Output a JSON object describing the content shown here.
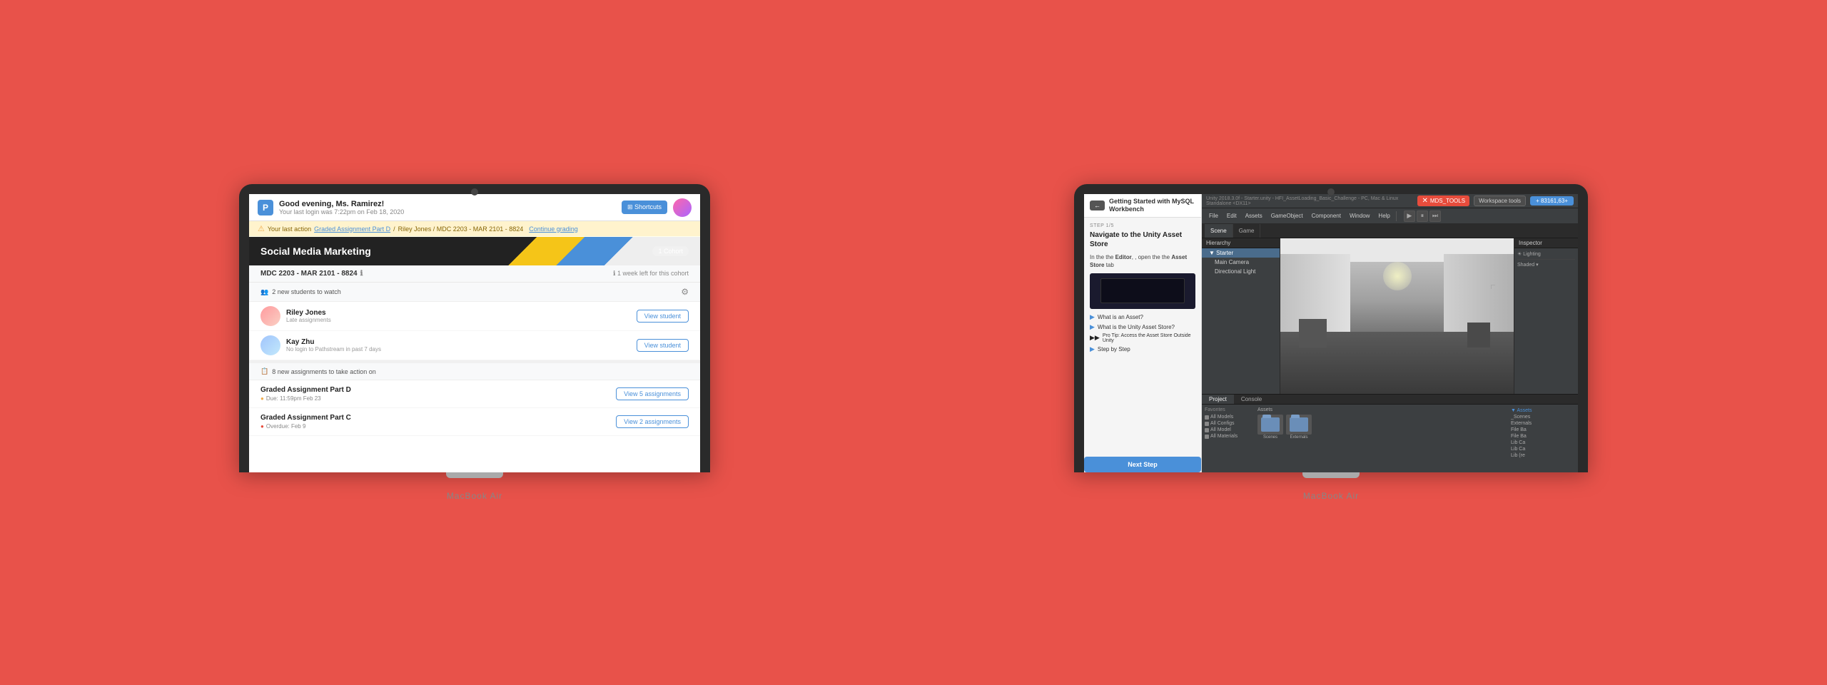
{
  "background": {
    "color": "#E8524A"
  },
  "left_laptop": {
    "brand": "MacBook Air",
    "header": {
      "greeting": "Good evening, Ms. Ramirez!",
      "last_login": "Your last login was 7:22pm on Feb 18, 2020",
      "shortcuts_label": "⊞ Shortcuts",
      "logo_text": "P"
    },
    "notification": {
      "icon": "⚠",
      "text": "Your last action",
      "link_text": "Graded Assignment Part D",
      "breadcrumb": "Riley Jones / MDC 2203 - MAR 2101 - 8824",
      "action_text": "Continue grading"
    },
    "course": {
      "title": "Social Media Marketing",
      "cohort_badge": "1 Cohort",
      "cohort_name": "MDC 2203 - MAR 2101 - 8824",
      "cohort_meta": "ℹ 1 week left for this cohort"
    },
    "students_watch": {
      "header": "2 new students to watch",
      "icon": "👥",
      "students": [
        {
          "name": "Riley Jones",
          "issue": "Late assignments",
          "btn_label": "View student"
        },
        {
          "name": "Kay Zhu",
          "issue": "No login to Pathstream in past 7 days",
          "btn_label": "View student"
        }
      ]
    },
    "assignments": {
      "header": "8 new assignments to take action on",
      "items": [
        {
          "name": "Graded Assignment Part D",
          "due": "Due: 11:59pm Feb 23",
          "due_color": "yellow",
          "btn_label": "View 5 assignments"
        },
        {
          "name": "Graded Assignment Part C",
          "due": "Overdue: Feb 9",
          "due_color": "red",
          "btn_label": "View 2 assignments"
        }
      ]
    }
  },
  "right_laptop": {
    "brand": "MacBook Air",
    "top_bar": {
      "breadcrumb": "Unity 2018.3.0f - Starter.unity - HFI_AssetLoading_Basic_Challenge - PC, Mac & Linux Standalone <DX11>",
      "tools_label": "MDS_TOOLS",
      "workspace_label": "Workspace tools",
      "add_label": "+ 83161,63+"
    },
    "menu": {
      "items": [
        "File",
        "Edit",
        "Assets",
        "GameObject",
        "Component",
        "Window",
        "Help"
      ]
    },
    "hierarchy": {
      "title": "Hierarchy",
      "items": [
        "▼ Starter",
        "Main Camera",
        "Directional Light"
      ]
    },
    "scene_tabs": [
      "Scene",
      "Game"
    ],
    "bottom_tabs": [
      "Project",
      "Console"
    ],
    "mysql_panel": {
      "title": "Getting Started with MySQL Workbench",
      "back_label": "←"
    },
    "lesson": {
      "step": "STEP 1/5",
      "title": "Navigate to the Unity Asset Store",
      "body_intro": "In the",
      "body_editor": "Editor",
      "body_middle": ", open the",
      "body_asset_store": "Asset Store",
      "body_tab": "tab",
      "accordion_items": [
        "What is an Asset?",
        "What is the Unity Asset Store?",
        "Pro Tip: Access the Asset Store Outside Unity",
        "Step by Step"
      ],
      "next_btn": "Next Step"
    },
    "project": {
      "favorites_title": "Favorites",
      "favorites": [
        "All Models",
        "All Configs",
        "All Model",
        "All Materials"
      ],
      "assets_title": "Assets",
      "asset_items": [
        "Scenes",
        "Externals"
      ],
      "asset_tree": [
        "▼ Assets",
        "  _Scenes",
        "  Externals",
        "  File Ba",
        "  File Ba",
        "  Lib Ca",
        "  Lib Ca",
        "  Lib (re"
      ],
      "inspector_title": "Inspector"
    }
  }
}
